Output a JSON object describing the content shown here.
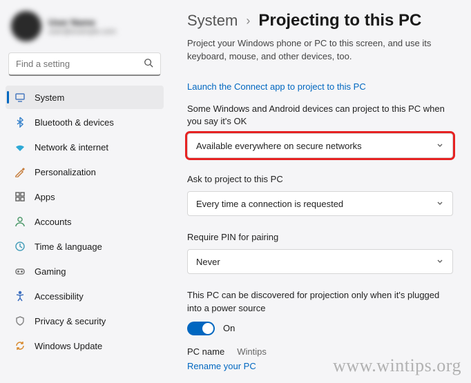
{
  "profile": {
    "name": "User Name",
    "email": "user@example.com"
  },
  "search": {
    "placeholder": "Find a setting"
  },
  "sidebar": {
    "items": [
      {
        "label": "System"
      },
      {
        "label": "Bluetooth & devices"
      },
      {
        "label": "Network & internet"
      },
      {
        "label": "Personalization"
      },
      {
        "label": "Apps"
      },
      {
        "label": "Accounts"
      },
      {
        "label": "Time & language"
      },
      {
        "label": "Gaming"
      },
      {
        "label": "Accessibility"
      },
      {
        "label": "Privacy & security"
      },
      {
        "label": "Windows Update"
      }
    ]
  },
  "breadcrumb": {
    "root": "System",
    "sep": "›",
    "leaf": "Projecting to this PC"
  },
  "description": "Project your Windows phone or PC to this screen, and use its keyboard, mouse, and other devices, too.",
  "link_launch": "Launch the Connect app to project to this PC",
  "settings": {
    "availability": {
      "label": "Some Windows and Android devices can project to this PC when you say it's OK",
      "value": "Available everywhere on secure networks"
    },
    "ask": {
      "label": "Ask to project to this PC",
      "value": "Every time a connection is requested"
    },
    "pin": {
      "label": "Require PIN for pairing",
      "value": "Never"
    },
    "discover": {
      "label": "This PC can be discovered for projection only when it's plugged into a power source",
      "value": "On"
    },
    "pcname": {
      "label": "PC name",
      "value": "Wintips",
      "rename": "Rename your PC"
    }
  },
  "watermark": "www.wintips.org"
}
